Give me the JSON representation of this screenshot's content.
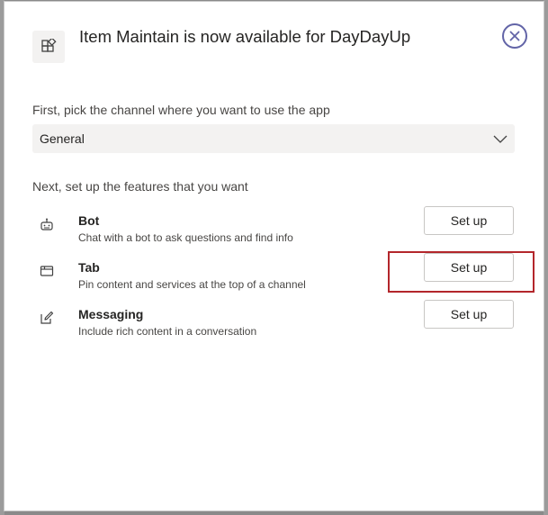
{
  "dialog": {
    "title": "Item Maintain is now available for DayDayUp",
    "app_icon": "apps-icon",
    "close_icon": "close-icon"
  },
  "channel": {
    "label": "First, pick the channel where you want to use the app",
    "selected": "General",
    "dropdown_icon": "chevron-down-icon"
  },
  "features": {
    "label": "Next, set up the features that you want",
    "items": [
      {
        "name": "Bot",
        "description": "Chat with a bot to ask questions and find info",
        "button_label": "Set up",
        "icon": "bot-icon"
      },
      {
        "name": "Tab",
        "description": "Pin content and services at the top of a channel",
        "button_label": "Set up",
        "icon": "tab-icon"
      },
      {
        "name": "Messaging",
        "description": "Include rich content in a conversation",
        "button_label": "Set up",
        "icon": "messaging-icon"
      }
    ]
  },
  "colors": {
    "accent": "#6264a7",
    "highlight": "#b3262b",
    "select_bg": "#f3f2f1"
  }
}
